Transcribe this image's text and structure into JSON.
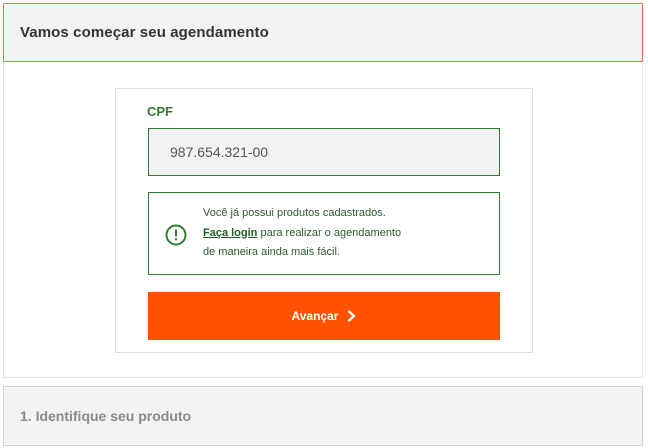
{
  "header": {
    "title": "Vamos começar seu agendamento"
  },
  "form": {
    "cpf_label": "CPF",
    "cpf_value": "987.654.321-00"
  },
  "notice": {
    "line1": "Você já possui produtos cadastrados.",
    "login_link": "Faça login",
    "line2_rest": " para realizar o agendamento",
    "line3": "de maneira ainda mais fácil.",
    "icon": "alert-circle-icon"
  },
  "actions": {
    "next_label": "Avançar",
    "next_icon": "chevron-right-icon"
  },
  "steps": {
    "step2_title": "1. Identifique seu produto"
  },
  "colors": {
    "accent_orange": "#ff5100",
    "success_green": "#2e7d32",
    "header_border": "#f0734f"
  }
}
